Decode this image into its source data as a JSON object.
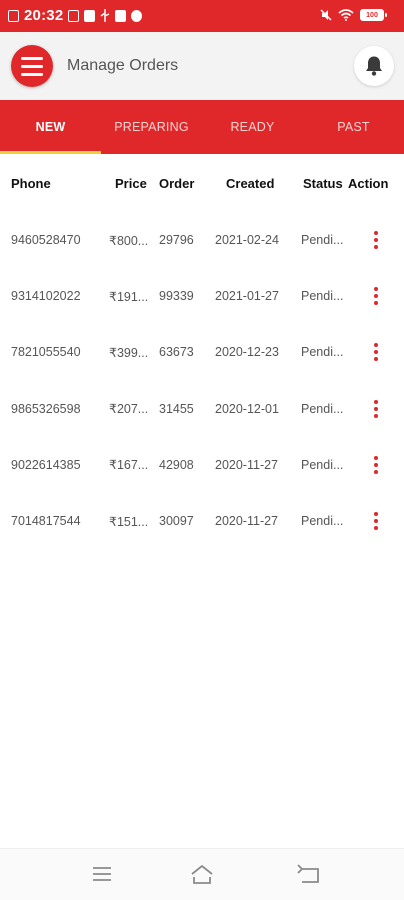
{
  "status_bar": {
    "time": "20:32",
    "battery": "100",
    "left_icons": [
      "screenshot-icon",
      "check-badge-icon",
      "phone-app-icon",
      "usb-icon",
      "facebook-icon",
      "messenger-icon"
    ],
    "right_icons": [
      "mute-icon",
      "wifi-icon",
      "battery-icon"
    ]
  },
  "header": {
    "title": "Manage Orders",
    "menu_icon": "hamburger-menu-icon",
    "notification_icon": "bell-icon"
  },
  "tabs": [
    {
      "label": "NEW",
      "active": true
    },
    {
      "label": "PREPARING",
      "active": false
    },
    {
      "label": "READY",
      "active": false
    },
    {
      "label": "PAST",
      "active": false
    }
  ],
  "table": {
    "columns": [
      "Phone",
      "Price",
      "Order",
      "Created",
      "Status",
      "Action"
    ],
    "rows": [
      {
        "phone": "9460528470",
        "price": "₹800...",
        "order": "29796",
        "created": "2021-02-24",
        "status": "Pendi..."
      },
      {
        "phone": "9314102022",
        "price": "₹191...",
        "order": "99339",
        "created": "2021-01-27",
        "status": "Pendi..."
      },
      {
        "phone": "7821055540",
        "price": "₹399...",
        "order": "63673",
        "created": "2020-12-23",
        "status": "Pendi..."
      },
      {
        "phone": "9865326598",
        "price": "₹207...",
        "order": "31455",
        "created": "2020-12-01",
        "status": "Pendi..."
      },
      {
        "phone": "9022614385",
        "price": "₹167...",
        "order": "42908",
        "created": "2020-11-27",
        "status": "Pendi..."
      },
      {
        "phone": "7014817544",
        "price": "₹151...",
        "order": "30097",
        "created": "2020-11-27",
        "status": "Pendi..."
      }
    ],
    "action_icon": "more-vertical-icon"
  },
  "nav_bar": {
    "icons": [
      "recent-apps-icon",
      "home-icon",
      "back-icon"
    ]
  },
  "colors": {
    "accent": "#e0282a",
    "tab_indicator": "#f2d23a",
    "header_bg": "#f3f3f3"
  }
}
